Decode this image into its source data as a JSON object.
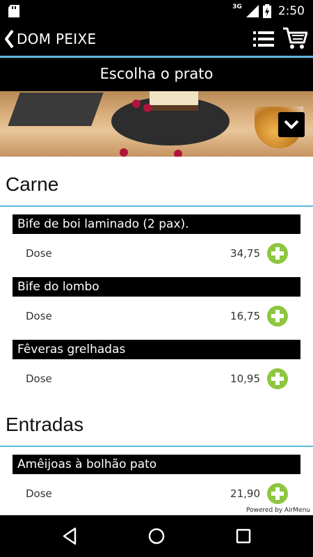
{
  "status_bar": {
    "network": "3G",
    "time": "2:50",
    "icons": [
      "sd-card-icon",
      "signal-icon",
      "battery-charging-icon"
    ]
  },
  "app_bar": {
    "title": "DOM PEIXE",
    "icons": [
      "back-chevron-icon",
      "menu-list-icon",
      "cart-icon"
    ]
  },
  "page": {
    "title": "Escolha o prato",
    "dropdown_icon": "chevron-down-icon"
  },
  "sections": [
    {
      "name": "Carne",
      "dishes": [
        {
          "name": "Bife de boi laminado (2 pax).",
          "portion": "Dose",
          "price": "34,75"
        },
        {
          "name": "Bife do lombo",
          "portion": "Dose",
          "price": "16,75"
        },
        {
          "name": "Fêveras grelhadas",
          "portion": "Dose",
          "price": "10,95"
        }
      ]
    },
    {
      "name": "Entradas",
      "dishes": [
        {
          "name": "Amêijoas à bolhão pato",
          "portion": "Dose",
          "price": "21,90"
        }
      ]
    }
  ],
  "footer": {
    "powered_by": "Powered by AirMenu"
  },
  "nav_bar": {
    "icons": [
      "back-triangle-icon",
      "home-circle-icon",
      "recents-square-icon"
    ]
  },
  "colors": {
    "accent_blue": "#5fb7dd",
    "add_green": "#8dc63f",
    "bar_black": "#000000"
  }
}
